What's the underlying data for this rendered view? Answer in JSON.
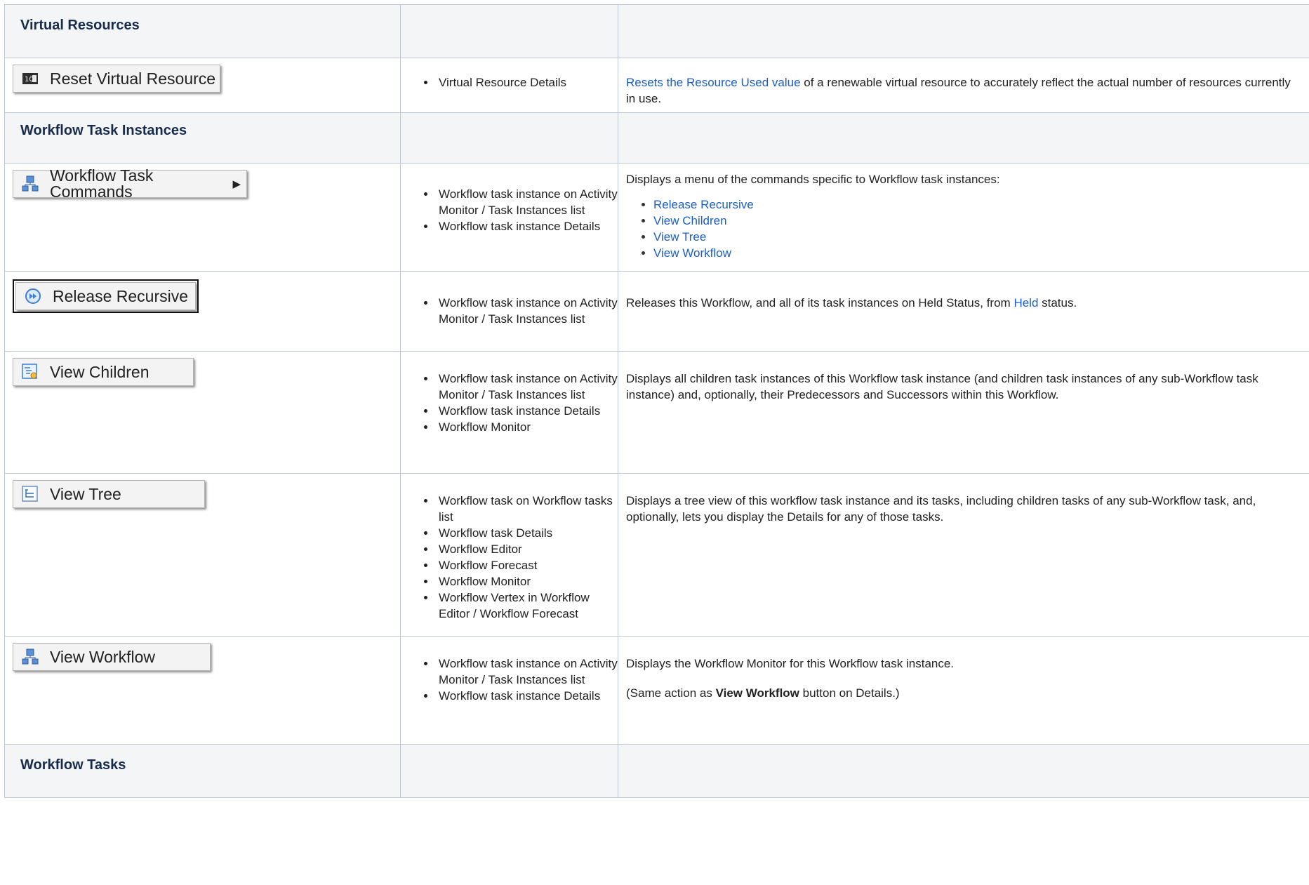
{
  "sections": {
    "virtual_resources": "Virtual Resources",
    "workflow_task_instances": "Workflow Task Instances",
    "workflow_tasks": "Workflow Tasks"
  },
  "rows": {
    "reset": {
      "button": "Reset Virtual Resource",
      "where": [
        "Virtual Resource Details"
      ],
      "desc_link": "Resets the Resource Used value",
      "desc_text": " of a renewable virtual resource to accurately reflect the actual number of resources currently in use."
    },
    "wtc": {
      "button": "Workflow Task Commands",
      "where": [
        "Workflow task instance on Activity Monitor / Task Instances list",
        "Workflow task instance Details"
      ],
      "desc_text": "Displays a menu of the commands specific to Workflow task instances:",
      "links": [
        "Release Recursive",
        "View Children",
        "View Tree",
        "View Workflow"
      ]
    },
    "release": {
      "button": "Release Recursive",
      "where": [
        "Workflow task instance on Activity Monitor / Task Instances list"
      ],
      "desc_pre": "Releases this Workflow, and all of its task instances on Held Status, from ",
      "desc_link": "Held",
      "desc_post": " status."
    },
    "children": {
      "button": "View Children",
      "where": [
        "Workflow task instance on Activity Monitor / Task Instances list",
        "Workflow task instance Details",
        "Workflow Monitor"
      ],
      "desc_text": "Displays all children task instances of this Workflow task instance (and children task instances of any sub-Workflow task instance) and, optionally, their Predecessors and Successors within this Workflow."
    },
    "tree": {
      "button": "View Tree",
      "where": [
        "Workflow task on Workflow tasks list",
        "Workflow task Details",
        "Workflow Editor",
        "Workflow Forecast",
        "Workflow Monitor",
        "Workflow Vertex in Workflow Editor / Workflow Forecast"
      ],
      "desc_text": "Displays a tree view of this workflow task instance and its tasks, including children tasks of any sub-Workflow task, and, optionally, lets you display the Details for any of those tasks."
    },
    "workflow": {
      "button": "View Workflow",
      "where": [
        "Workflow task instance on Activity Monitor / Task Instances list",
        "Workflow task instance Details"
      ],
      "desc_text": "Displays the Workflow Monitor for this Workflow task instance.",
      "note_pre": "(Same action as ",
      "note_bold": "View Workflow",
      "note_post": " button on Details.)"
    }
  }
}
